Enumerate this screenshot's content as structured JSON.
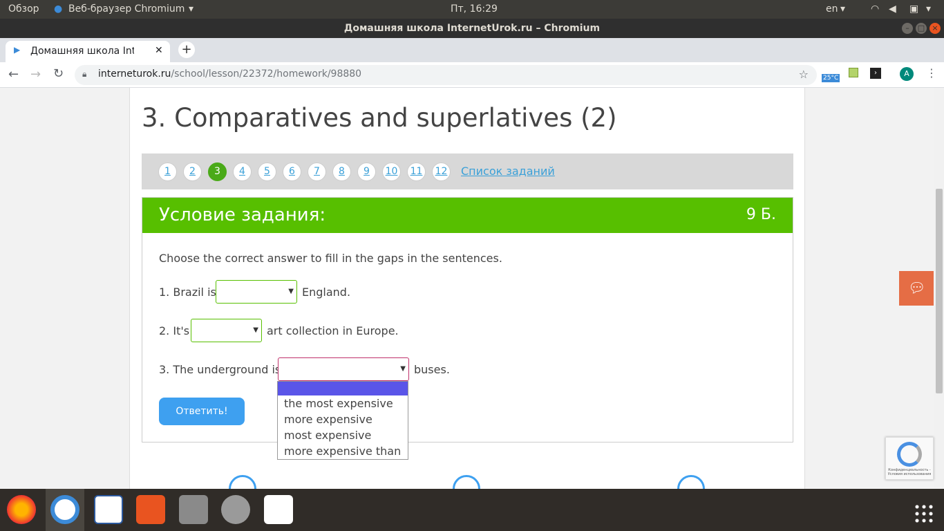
{
  "system": {
    "overview": "Обзор",
    "app_menu": "Веб-браузер Chromium",
    "clock": "Пт, 16:29",
    "lang": "en"
  },
  "window": {
    "title": "Домашняя школа InternetUrok.ru – Chromium"
  },
  "browser": {
    "tab_title": "Домашняя школа Interne",
    "url_domain": "interneturok.ru",
    "url_path": "/school/lesson/22372/homework/98880",
    "weather": "25°C",
    "profile_letter": "A"
  },
  "page": {
    "title": "3. Comparatives and superlatives (2)",
    "pages": [
      "1",
      "2",
      "3",
      "4",
      "5",
      "6",
      "7",
      "8",
      "9",
      "10",
      "11",
      "12"
    ],
    "active_page": "3",
    "task_list_link": "Список заданий",
    "task_header": "Условие задания:",
    "score": "9 Б.",
    "instruction": "Choose the correct answer to fill in the gaps in the sentences.",
    "q1_before": "1. Brazil is",
    "q1_after": "England.",
    "q2_before": "2. It's",
    "q2_after": "art collection in Europe.",
    "q3_before": "3. The underground is",
    "q3_after": "buses.",
    "dropdown_options": [
      "the most expensive",
      "more expensive",
      "most expensive",
      "more expensive than"
    ],
    "submit": "Ответить!",
    "recaptcha_text": "Конфиденциальность - Условия использования"
  },
  "colors": {
    "accent_green": "#57bf00",
    "link_blue": "#3aa0d8",
    "button_blue": "#3ea0f0",
    "chat_orange": "#e56d45"
  }
}
